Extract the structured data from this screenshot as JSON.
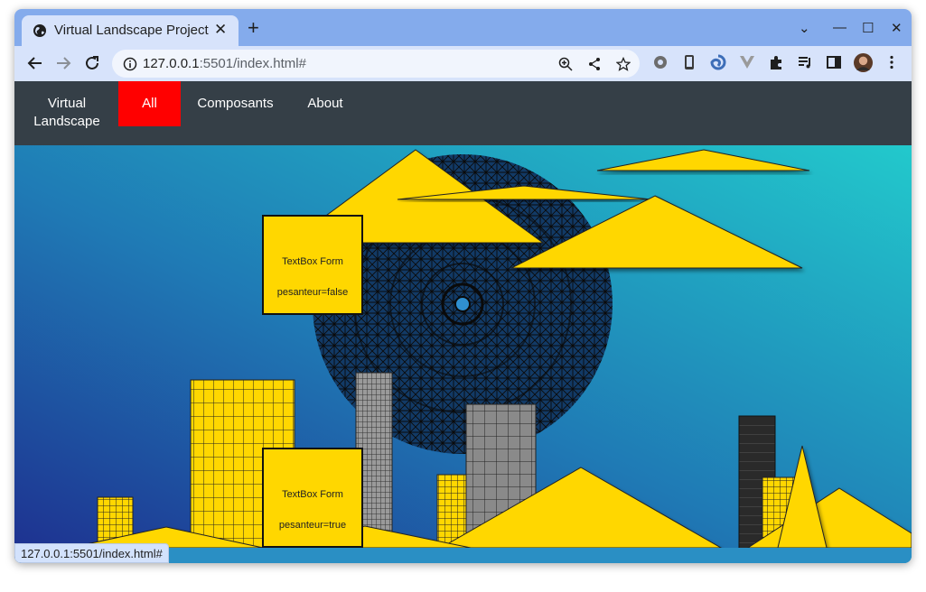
{
  "browser": {
    "tab_title": "Virtual Landscape Project",
    "tab_close_icon": "close-icon",
    "new_tab_label": "+",
    "url_host": "127.0.0.1",
    "url_path": ":5501/index.html#",
    "status_url": "127.0.0.1:5501/index.html#",
    "window_controls": {
      "collapse": "⌄",
      "minimize": "—",
      "maximize": "☐",
      "close": "✕"
    },
    "colors": {
      "tabstrip": "#84abec",
      "toolbar": "#d7e3fb"
    }
  },
  "site": {
    "nav": {
      "brand": "Virtual Landscape",
      "items": [
        {
          "label": "All",
          "active": true
        },
        {
          "label": "Composants",
          "active": false
        },
        {
          "label": "About",
          "active": false
        }
      ]
    },
    "textboxes": [
      {
        "title": "TextBox Form",
        "prop": "pesanteur=false"
      },
      {
        "title": "TextBox Form",
        "prop": "pesanteur=true"
      }
    ],
    "colors": {
      "nav_bg": "#353f47",
      "active": "#ff0000",
      "shape_fill": "#ffd700",
      "sky_top": "#1b5fa6",
      "sky_right": "#22c9cc"
    }
  }
}
